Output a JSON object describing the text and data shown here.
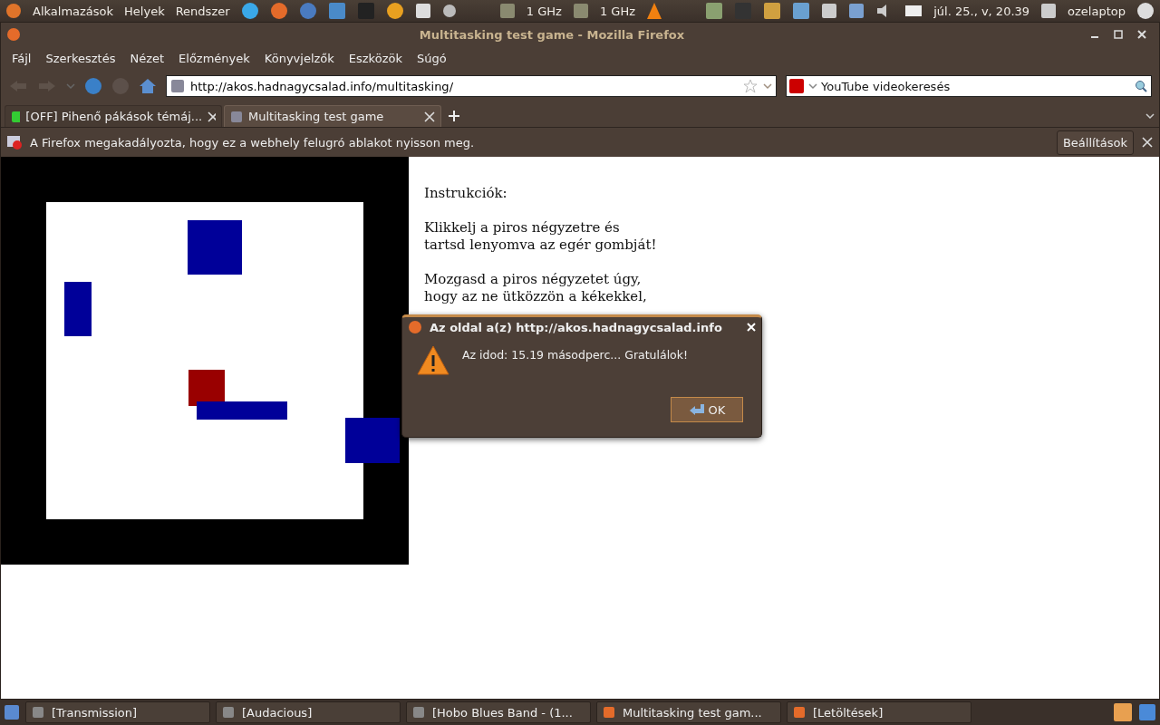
{
  "top_panel": {
    "menus": [
      "Alkalmazások",
      "Helyek",
      "Rendszer"
    ],
    "cpu_readings": [
      "1 GHz",
      "1 GHz"
    ],
    "clock": "júl. 25., v, 20.39",
    "user": "ozelaptop"
  },
  "window": {
    "title": "Multitasking test game - Mozilla Firefox"
  },
  "menu_bar": [
    "Fájl",
    "Szerkesztés",
    "Nézet",
    "Előzmények",
    "Könyvjelzők",
    "Eszközök",
    "Súgó"
  ],
  "address_bar": {
    "value": "http://akos.hadnagycsalad.info/multitasking/"
  },
  "search": {
    "placeholder": "YouTube videokeresés"
  },
  "tabs": [
    {
      "label": "[OFF] Pihenő pákások témáj...",
      "selected": false
    },
    {
      "label": "Multitasking test game",
      "selected": true
    }
  ],
  "notification": {
    "message": "A Firefox megakadályozta, hogy ez a webhely felugró ablakot nyisson meg.",
    "button": "Beállítások"
  },
  "page": {
    "heading": "Instrukciók:",
    "paragraphs": [
      [
        "Klikkelj a piros négyzetre és",
        "tartsd lenyomva az egér gombját!"
      ],
      [
        "Mozgasd a piros négyzetet úgy,",
        "hogy az ne ütközzön a kékekkel,"
      ]
    ]
  },
  "dialog": {
    "title": "Az oldal a(z) http://akos.hadnagycsalad.info",
    "message": "Az idod: 15.19 másodperc... Gratulálok!",
    "button": "OK"
  },
  "taskbar": [
    "[Transmission]",
    "[Audacious]",
    "[Hobo Blues Band - (1...",
    "Multitasking test gam...",
    "[Letöltések]"
  ]
}
